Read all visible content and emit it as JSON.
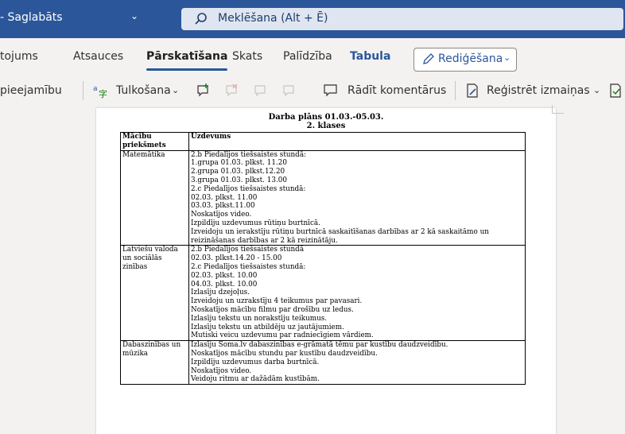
{
  "titlebar": {
    "saved_label": "- Saglabāts",
    "search_placeholder": "Meklēšana (Alt + Ē)"
  },
  "tabs": [
    {
      "label": "tojums"
    },
    {
      "label": "Atsauces"
    },
    {
      "label": "Pārskatīšana",
      "active": true
    },
    {
      "label": "Skats"
    },
    {
      "label": "Palīdzība"
    },
    {
      "label": "Tabula"
    }
  ],
  "edit_mode": {
    "label": "Rediģēšana"
  },
  "toolbar": {
    "accessibility_label": "pieejamību",
    "translate_label": "Tulkošana",
    "show_comments_label": "Rādīt komentārus",
    "track_changes_label": "Reģistrēt izmaiņas"
  },
  "document": {
    "title": "Darba plāns 01.03.-05.03.",
    "subtitle": "2. klases",
    "table": {
      "headers": [
        "Mācību priekšmets",
        "Uzdevums"
      ],
      "rows": [
        {
          "subject": "Matemātika",
          "lines": [
            "2.b Piedalījos tiešsaistes stundā:",
            "1.grupa 01.03. plkst. 11.20",
            "2.grupa 01.03. plkst.12.20",
            "3.grupa 01.03. plkst. 13.00",
            "2.c Piedalījos tiešsaistes stundā:",
            "02.03. plkst. 11.00",
            " 03.03. plkst.11.00",
            "Noskatījos video.",
            "Izpildīju uzdevumus rūtiņu burtnīcā.",
            "Izveidoju un ierakstīju rūtiņu burtnīcā saskaitīšanas darbības  ar 2 kā saskaitāmo un",
            "reizināšanas darbības ar 2 kā reizinātāju."
          ]
        },
        {
          "subject": "Latviešu valoda un sociālās zinības",
          "lines": [
            "2.b Piedalījos tiešsaistes stundā",
            "02.03. plkst.14.20 - 15.00",
            "2.c Piedalījos tiešsaistes stundā:",
            " 02.03. plkst. 10.00",
            "04.03. plkst. 10.00",
            "Izlasīju dzejoļus.",
            "Izveidoju un uzrakstīju 4 teikumus par pavasari.",
            "Noskatījos mācību filmu par drošību uz ledus.",
            "Izlasīju tekstu un norakstīju teikumus.",
            "Izlasīju tekstu un atbildēju uz jautājumiem.",
            "Mutiski veicu uzdevumu par radniecīgiem vārdiem."
          ]
        },
        {
          "subject": "Dabaszinības un mūzika",
          "lines": [
            "Izlasīju Soma.lv dabaszinības e-grāmatā tēmu par kustību daudzveidību.",
            "Noskatījos mācību stundu par kustību daudzveidību.",
            "Izpildīju uzdevumus darba burtnīcā.",
            "Noskatījos video.",
            "Veidoju ritmu ar dažādām kustībām."
          ]
        }
      ]
    }
  },
  "colors": {
    "titlebar": "#2b579a",
    "accent": "#2b579a",
    "canvas": "#f3f2f1"
  },
  "icons": [
    "search-icon",
    "pen-icon",
    "translate-icon",
    "new-comment-icon",
    "delete-comment-icon",
    "previous-comment-icon",
    "next-comment-icon",
    "comment-icon",
    "track-changes-icon",
    "accept-icon"
  ]
}
